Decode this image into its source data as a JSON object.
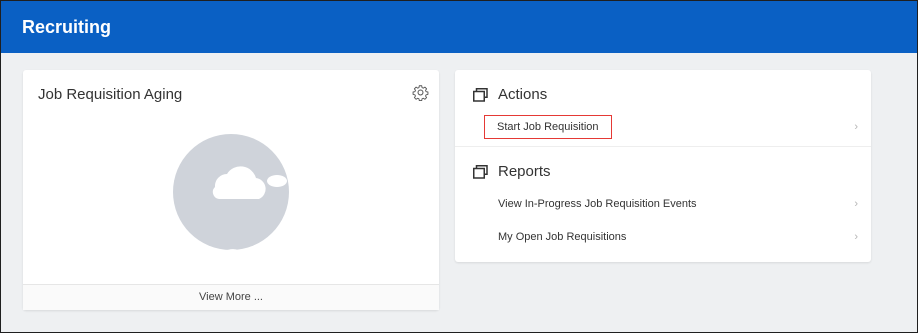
{
  "header": {
    "title": "Recruiting",
    "background": "#0a60c4"
  },
  "aging_card": {
    "title": "Job Requisition Aging",
    "settings_icon": "gear-icon",
    "illustration": "cloud-empty-state",
    "view_more_label": "View More ..."
  },
  "actions": {
    "heading": "Actions",
    "icon": "windows-icon",
    "items": [
      {
        "label": "Start Job Requisition",
        "highlighted": true,
        "highlight_color": "#e53935"
      }
    ]
  },
  "reports": {
    "heading": "Reports",
    "icon": "windows-icon",
    "items": [
      {
        "label": "View In-Progress Job Requisition Events"
      },
      {
        "label": "My Open Job Requisitions"
      }
    ]
  },
  "chevron_glyph": "›"
}
